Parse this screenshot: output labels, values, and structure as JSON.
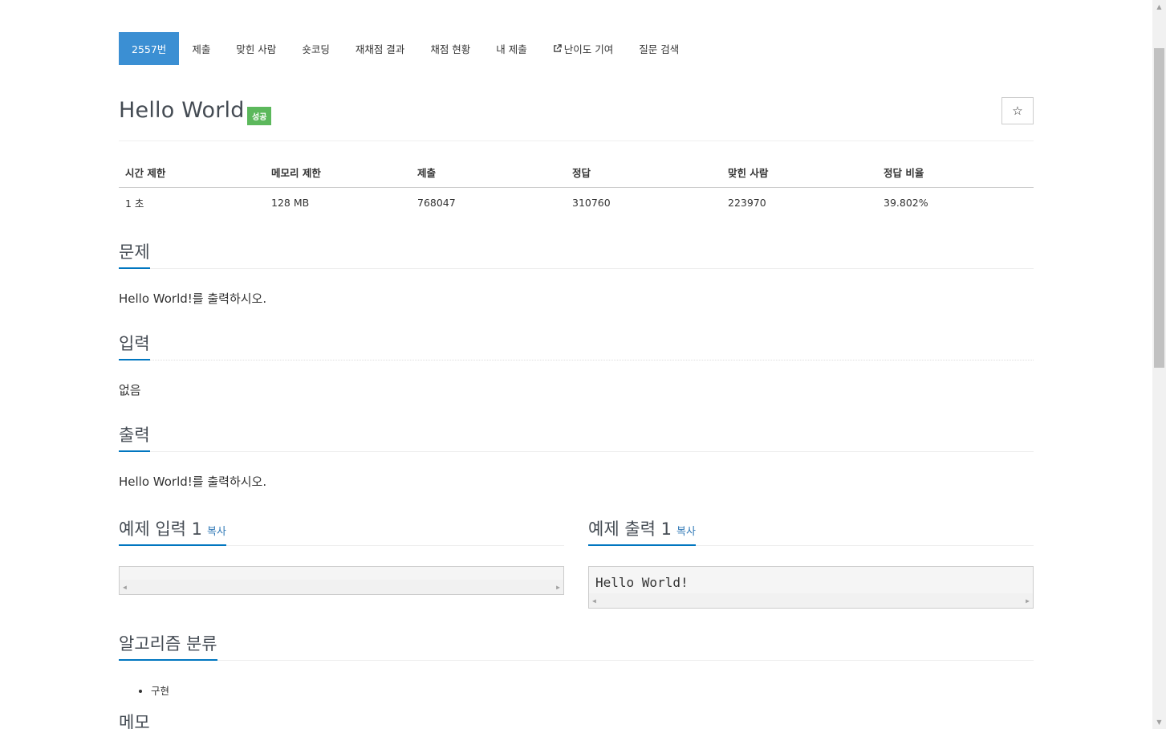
{
  "tabs": [
    {
      "label": "2557번",
      "active": true
    },
    {
      "label": "제출"
    },
    {
      "label": "맞힌 사람"
    },
    {
      "label": "숏코딩"
    },
    {
      "label": "재채점 결과"
    },
    {
      "label": "채점 현황"
    },
    {
      "label": "내 제출"
    },
    {
      "label": "난이도 기여",
      "icon": "external-link-icon"
    },
    {
      "label": "질문 검색"
    }
  ],
  "problem": {
    "title": "Hello World",
    "badge": "성공",
    "star_icon": "☆"
  },
  "info": {
    "headers": [
      "시간 제한",
      "메모리 제한",
      "제출",
      "정답",
      "맞힌 사람",
      "정답 비율"
    ],
    "values": [
      "1 초",
      "128 MB",
      "768047",
      "310760",
      "223970",
      "39.802%"
    ]
  },
  "sections": {
    "problem": {
      "title": "문제",
      "text": "Hello World!를 출력하시오."
    },
    "input": {
      "title": "입력",
      "text": "없음"
    },
    "output": {
      "title": "출력",
      "text": "Hello World!를 출력하시오."
    },
    "sample_input": {
      "title": "예제 입력 1",
      "copy": "복사",
      "text": ""
    },
    "sample_output": {
      "title": "예제 출력 1",
      "copy": "복사",
      "text": "Hello World!"
    },
    "algorithm": {
      "title": "알고리즘 분류",
      "tags": [
        "구현"
      ]
    },
    "memo": {
      "title": "메모"
    }
  },
  "colors": {
    "accent": "#0076c0",
    "active_tab": "#3b8fd3",
    "success_badge": "#5cb85c"
  }
}
